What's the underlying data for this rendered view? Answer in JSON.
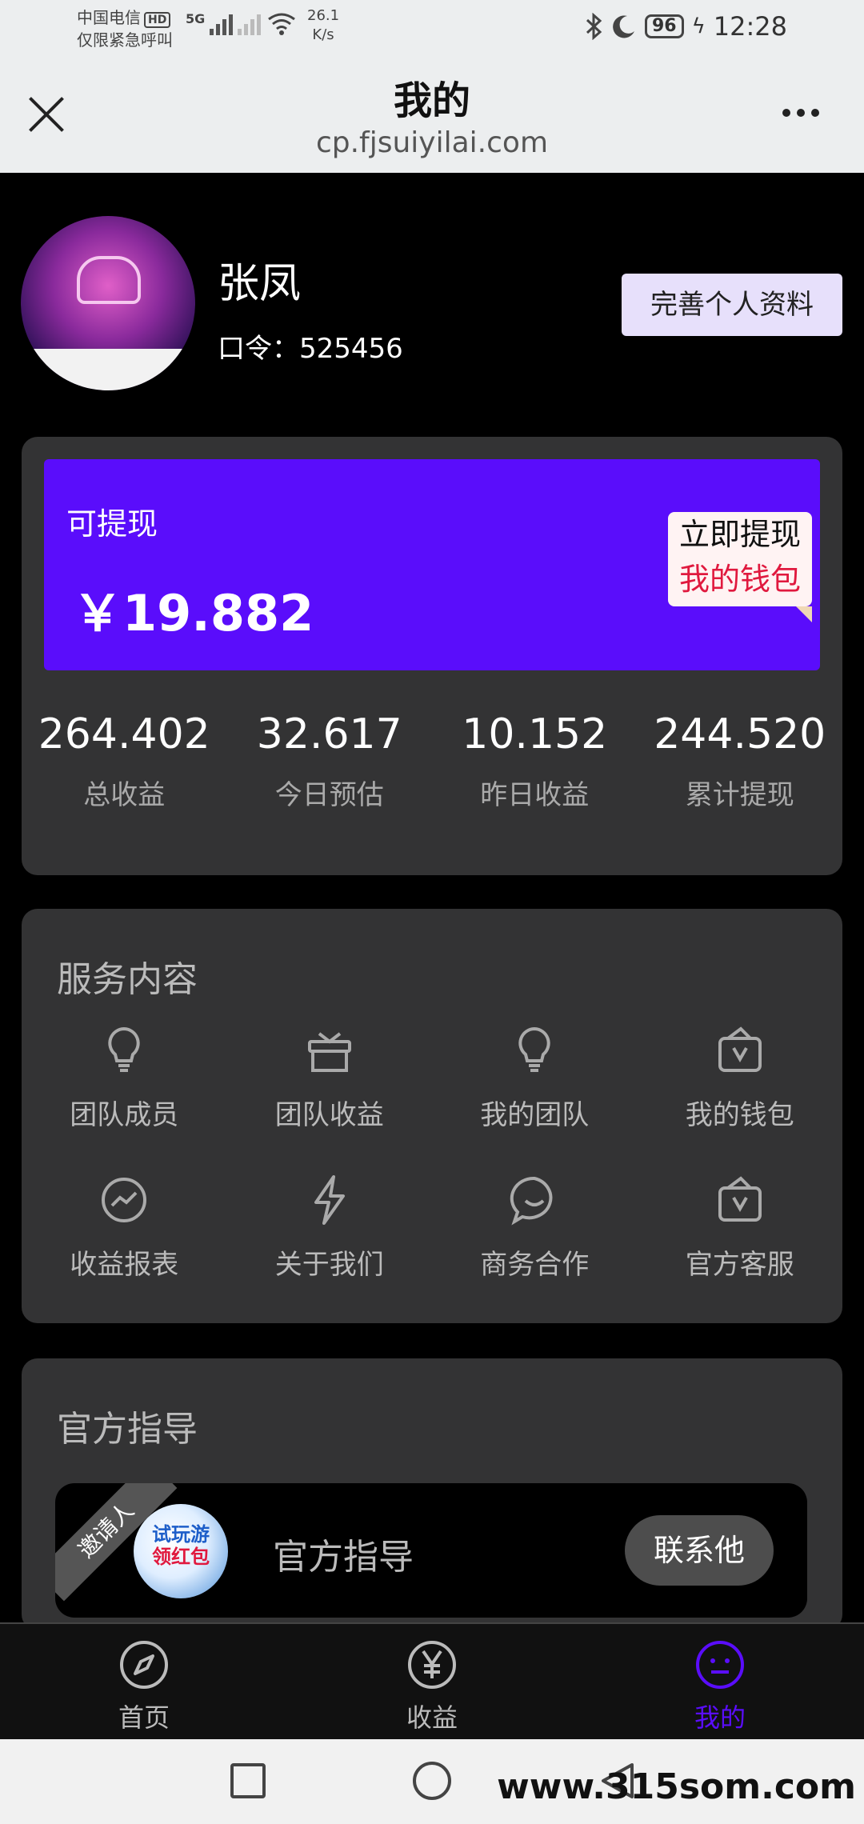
{
  "status_bar": {
    "carrier_line1": "中国电信",
    "carrier_hd": "HD",
    "carrier_line2": "仅限紧急呼叫",
    "network": "5G",
    "speed_value": "26.1",
    "speed_unit": "K/s",
    "battery": "96",
    "time": "12:28"
  },
  "title_bar": {
    "title": "我的",
    "domain": "cp.fjsuiyilai.com"
  },
  "profile": {
    "name": "张凤",
    "code": "口令：525456",
    "edit_button": "完善个人资料"
  },
  "withdraw": {
    "label": "可提现",
    "amount": "￥19.882",
    "sticker_line1": "立即提现",
    "sticker_line2": "我的钱包",
    "accent_color": "#5a0dfb"
  },
  "stats": [
    {
      "value": "264.402",
      "label": "总收益"
    },
    {
      "value": "32.617",
      "label": "今日预估"
    },
    {
      "value": "10.152",
      "label": "昨日收益"
    },
    {
      "value": "244.520",
      "label": "累计提现"
    }
  ],
  "services": {
    "title": "服务内容",
    "items": [
      {
        "label": "团队成员",
        "icon": "lightbulb-icon"
      },
      {
        "label": "团队收益",
        "icon": "gift-icon"
      },
      {
        "label": "我的团队",
        "icon": "lightbulb-icon"
      },
      {
        "label": "我的钱包",
        "icon": "wallet-icon"
      },
      {
        "label": "收益报表",
        "icon": "trend-icon"
      },
      {
        "label": "关于我们",
        "icon": "lightning-icon"
      },
      {
        "label": "商务合作",
        "icon": "chat-smile-icon"
      },
      {
        "label": "官方客服",
        "icon": "wallet-icon"
      }
    ]
  },
  "guide": {
    "title": "官方指导",
    "ribbon": "邀请人",
    "thumb_line1": "试玩游",
    "thumb_line2": "领红包",
    "row_title": "官方指导",
    "contact_button": "联系他"
  },
  "tabbar": {
    "tabs": [
      {
        "label": "首页",
        "icon": "compass-icon",
        "active": false
      },
      {
        "label": "收益",
        "icon": "yen-icon",
        "active": false
      },
      {
        "label": "我的",
        "icon": "smile-icon",
        "active": true
      }
    ]
  },
  "watermark": "www.315som.com"
}
